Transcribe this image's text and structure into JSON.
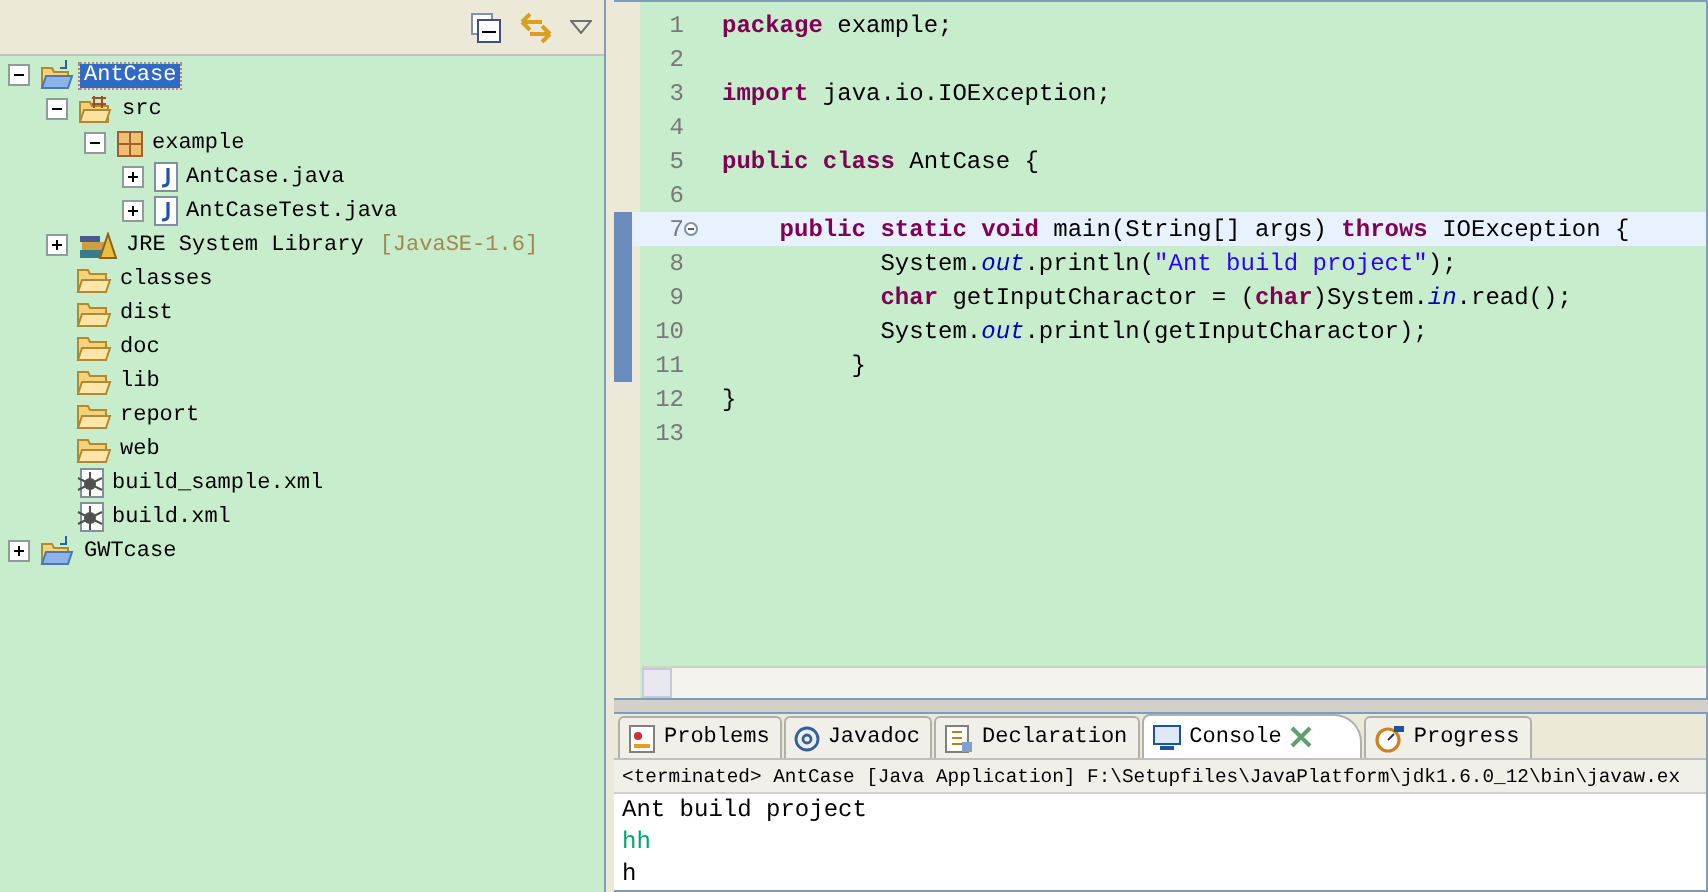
{
  "explorer": {
    "tree": [
      {
        "label": "AntCase",
        "kind": "project",
        "expanded": true,
        "selected": true,
        "children": [
          {
            "label": "src",
            "kind": "source-folder",
            "expanded": true,
            "selected": false,
            "children": [
              {
                "label": "example",
                "kind": "package",
                "expanded": true,
                "selected": false,
                "children": [
                  {
                    "label": "AntCase.java",
                    "kind": "java-file",
                    "expanded": false,
                    "selected": false
                  },
                  {
                    "label": "AntCaseTest.java",
                    "kind": "java-file",
                    "expanded": false,
                    "selected": false
                  }
                ]
              }
            ]
          },
          {
            "label": "JRE System Library",
            "suffix": "[JavaSE-1.6]",
            "kind": "library",
            "expanded": false,
            "selected": false
          },
          {
            "label": "classes",
            "kind": "folder",
            "selected": false
          },
          {
            "label": "dist",
            "kind": "folder",
            "selected": false
          },
          {
            "label": "doc",
            "kind": "folder",
            "selected": false
          },
          {
            "label": "lib",
            "kind": "folder",
            "selected": false
          },
          {
            "label": "report",
            "kind": "folder",
            "selected": false
          },
          {
            "label": "web",
            "kind": "folder",
            "selected": false
          },
          {
            "label": "build_sample.xml",
            "kind": "xml-file",
            "selected": false
          },
          {
            "label": "build.xml",
            "kind": "xml-file",
            "selected": false
          }
        ]
      },
      {
        "label": "GWTcase",
        "kind": "project",
        "expanded": false,
        "selected": false
      }
    ]
  },
  "editor": {
    "lines": [
      {
        "number": "1",
        "current": false,
        "changed": false,
        "segments": [
          {
            "kind": "keyword",
            "text": "package"
          },
          {
            "kind": "plain",
            "text": " example;"
          }
        ]
      },
      {
        "number": "2",
        "current": false,
        "changed": false
      },
      {
        "number": "3",
        "current": false,
        "changed": false,
        "segments": [
          {
            "kind": "keyword",
            "text": "import"
          },
          {
            "kind": "plain",
            "text": " java.io.IOException;"
          }
        ]
      },
      {
        "number": "4",
        "current": false,
        "changed": false
      },
      {
        "number": "5",
        "current": false,
        "changed": false,
        "segments": [
          {
            "kind": "keyword",
            "text": "public class"
          },
          {
            "kind": "plain",
            "text": " AntCase {"
          }
        ]
      },
      {
        "number": "6",
        "current": false,
        "changed": false
      },
      {
        "number": "7",
        "current": true,
        "changed": true,
        "fold": true,
        "segments": [
          {
            "kind": "keyword",
            "text": "    public static void"
          },
          {
            "kind": "plain",
            "text": " main(String[] args) "
          },
          {
            "kind": "keyword",
            "text": "throws"
          },
          {
            "kind": "plain",
            "text": " IOException {"
          }
        ]
      },
      {
        "number": "8",
        "current": false,
        "changed": true,
        "segments": [
          {
            "kind": "plain",
            "text": "           System."
          },
          {
            "kind": "field",
            "text": "out"
          },
          {
            "kind": "plain",
            "text": ".println("
          },
          {
            "kind": "string",
            "text": "\"Ant build project\""
          },
          {
            "kind": "plain",
            "text": ");"
          }
        ]
      },
      {
        "number": "9",
        "current": false,
        "changed": true,
        "segments": [
          {
            "kind": "keyword",
            "text": "           char"
          },
          {
            "kind": "plain",
            "text": " getInputCharactor = ("
          },
          {
            "kind": "keyword",
            "text": "char"
          },
          {
            "kind": "plain",
            "text": ")System."
          },
          {
            "kind": "field",
            "text": "in"
          },
          {
            "kind": "plain",
            "text": ".read();"
          }
        ]
      },
      {
        "number": "10",
        "current": false,
        "changed": true,
        "segments": [
          {
            "kind": "plain",
            "text": "           System."
          },
          {
            "kind": "field",
            "text": "out"
          },
          {
            "kind": "plain",
            "text": ".println(getInputCharactor);"
          }
        ]
      },
      {
        "number": "11",
        "current": false,
        "changed": true,
        "segments": [
          {
            "kind": "plain",
            "text": "         }"
          }
        ]
      },
      {
        "number": "12",
        "current": false,
        "changed": false,
        "segments": [
          {
            "kind": "plain",
            "text": "}"
          }
        ]
      },
      {
        "number": "13",
        "current": false,
        "changed": false
      }
    ]
  },
  "bottom_panel": {
    "tabs": [
      {
        "label": "Problems",
        "kind": "problems",
        "selected": false,
        "closable": false
      },
      {
        "label": "Javadoc",
        "kind": "javadoc",
        "selected": false,
        "closable": false
      },
      {
        "label": "Declaration",
        "kind": "declaration",
        "selected": false,
        "closable": false
      },
      {
        "label": "Console",
        "kind": "console",
        "selected": true,
        "closable": true
      },
      {
        "label": "Progress",
        "kind": "progress",
        "selected": false,
        "closable": false
      }
    ],
    "console_title": "<terminated> AntCase [Java Application] F:\\Setupfiles\\JavaPlatform\\jdk1.6.0_12\\bin\\javaw.ex",
    "output": [
      {
        "kind": "output",
        "text": "Ant build project"
      },
      {
        "kind": "input",
        "text": "hh"
      },
      {
        "kind": "output",
        "text": "h"
      }
    ]
  }
}
